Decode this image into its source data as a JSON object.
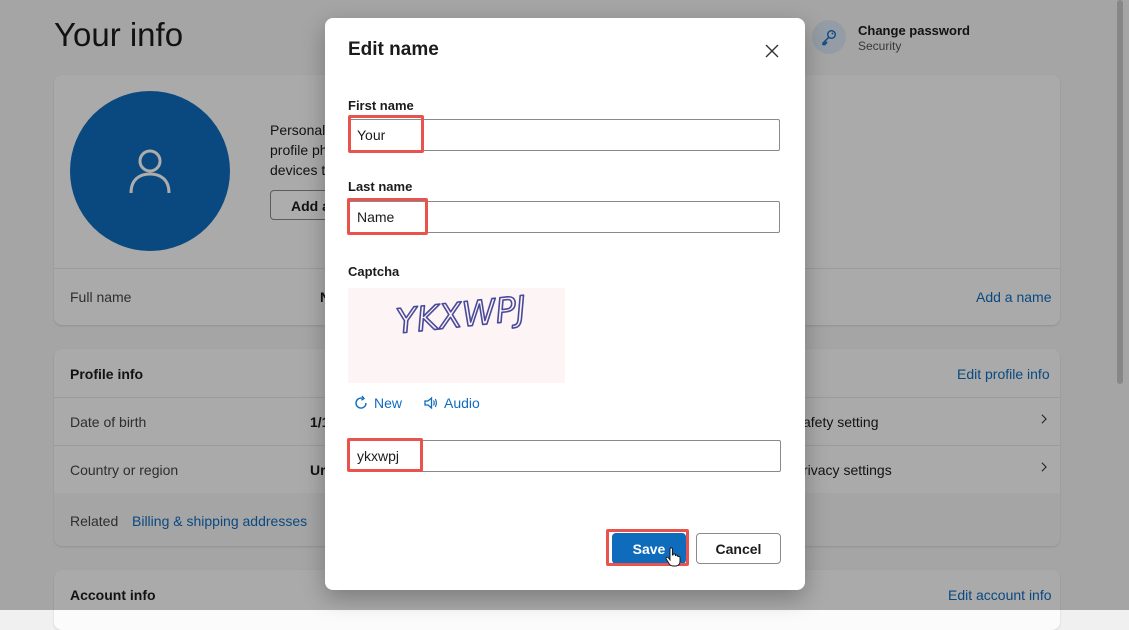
{
  "page": {
    "title": "Your info",
    "change_password": {
      "title": "Change password",
      "subtitle": "Security",
      "icon": "key-icon"
    },
    "profile_card": {
      "personalize_text": [
        "Personali",
        "profile ph",
        "devices t"
      ],
      "add_button_label": "Add a",
      "full_name_label": "Full name",
      "full_name_value": "N",
      "add_name_link": "Add a name"
    },
    "profile_info": {
      "heading": "Profile info",
      "edit_link": "Edit profile info",
      "rows": [
        {
          "label": "Date of birth",
          "value": "1/1",
          "right": "afety setting"
        },
        {
          "label": "Country or region",
          "value": "Ur",
          "right": "rivacy settings"
        }
      ],
      "related_label": "Related",
      "related_link": "Billing & shipping addresses"
    },
    "account_info": {
      "heading": "Account info",
      "edit_link": "Edit account info"
    }
  },
  "dialog": {
    "title": "Edit name",
    "first_name_label": "First name",
    "first_name_value": "Your",
    "last_name_label": "Last name",
    "last_name_value": "Name",
    "captcha_label": "Captcha",
    "captcha_text": "YKXWPJ",
    "captcha_new": "New",
    "captcha_audio": "Audio",
    "captcha_value": "ykxwpj",
    "save_label": "Save",
    "cancel_label": "Cancel"
  },
  "colors": {
    "accent": "#0f6cbd",
    "highlight": "#e8534d",
    "avatar": "#0f6cbd"
  }
}
